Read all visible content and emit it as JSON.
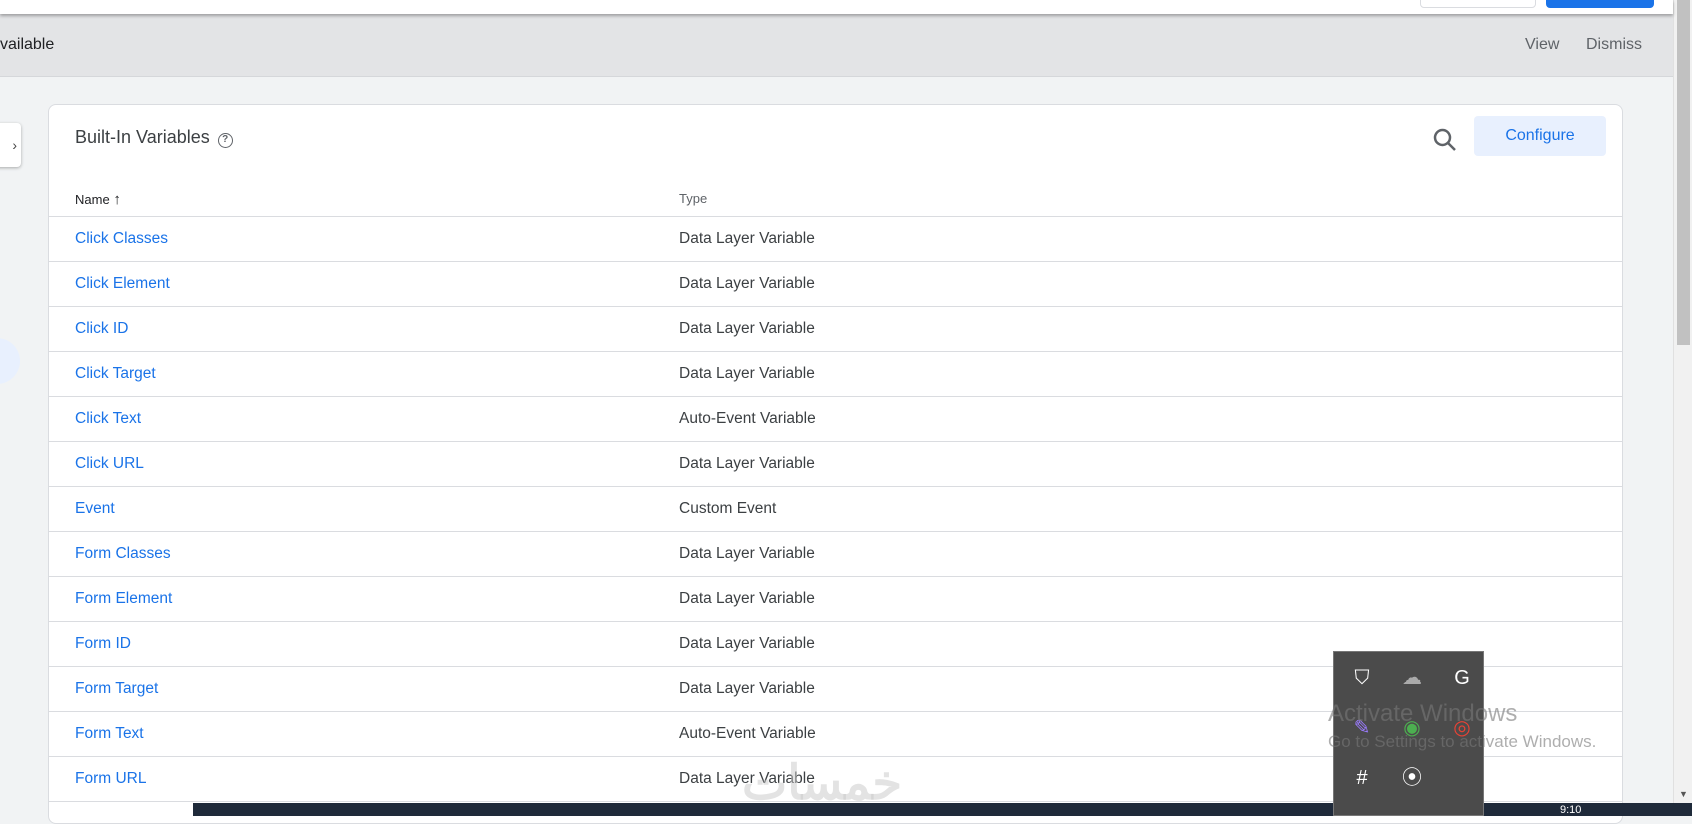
{
  "banner": {
    "message": "vailable",
    "view": "View",
    "dismiss": "Dismiss"
  },
  "card": {
    "title": "Built-In Variables",
    "help_icon": "help-circle-icon",
    "configure": "Configure",
    "search_icon": "search-icon"
  },
  "table": {
    "columns": [
      "Name",
      "Type"
    ],
    "sort_icon": "arrow-up-icon",
    "rows": [
      {
        "name": "Click Classes",
        "type": "Data Layer Variable"
      },
      {
        "name": "Click Element",
        "type": "Data Layer Variable"
      },
      {
        "name": "Click ID",
        "type": "Data Layer Variable"
      },
      {
        "name": "Click Target",
        "type": "Data Layer Variable"
      },
      {
        "name": "Click Text",
        "type": "Auto-Event Variable"
      },
      {
        "name": "Click URL",
        "type": "Data Layer Variable"
      },
      {
        "name": "Event",
        "type": "Custom Event"
      },
      {
        "name": "Form Classes",
        "type": "Data Layer Variable"
      },
      {
        "name": "Form Element",
        "type": "Data Layer Variable"
      },
      {
        "name": "Form ID",
        "type": "Data Layer Variable"
      },
      {
        "name": "Form Target",
        "type": "Data Layer Variable"
      },
      {
        "name": "Form Text",
        "type": "Auto-Event Variable"
      },
      {
        "name": "Form URL",
        "type": "Data Layer Variable"
      }
    ]
  },
  "windows": {
    "activate_title": "Activate Windows",
    "activate_sub": "Go to Settings to activate Windows.",
    "clock": "9:10",
    "tray_icons": [
      "security-warning-icon",
      "onedrive-off-icon",
      "grammarly-icon",
      "feather-icon",
      "download-manager-icon",
      "chrome-icon",
      "slack-icon",
      "record-icon"
    ]
  },
  "colors": {
    "accent": "#1a73e8",
    "configure_bg": "#e8f0fe"
  }
}
